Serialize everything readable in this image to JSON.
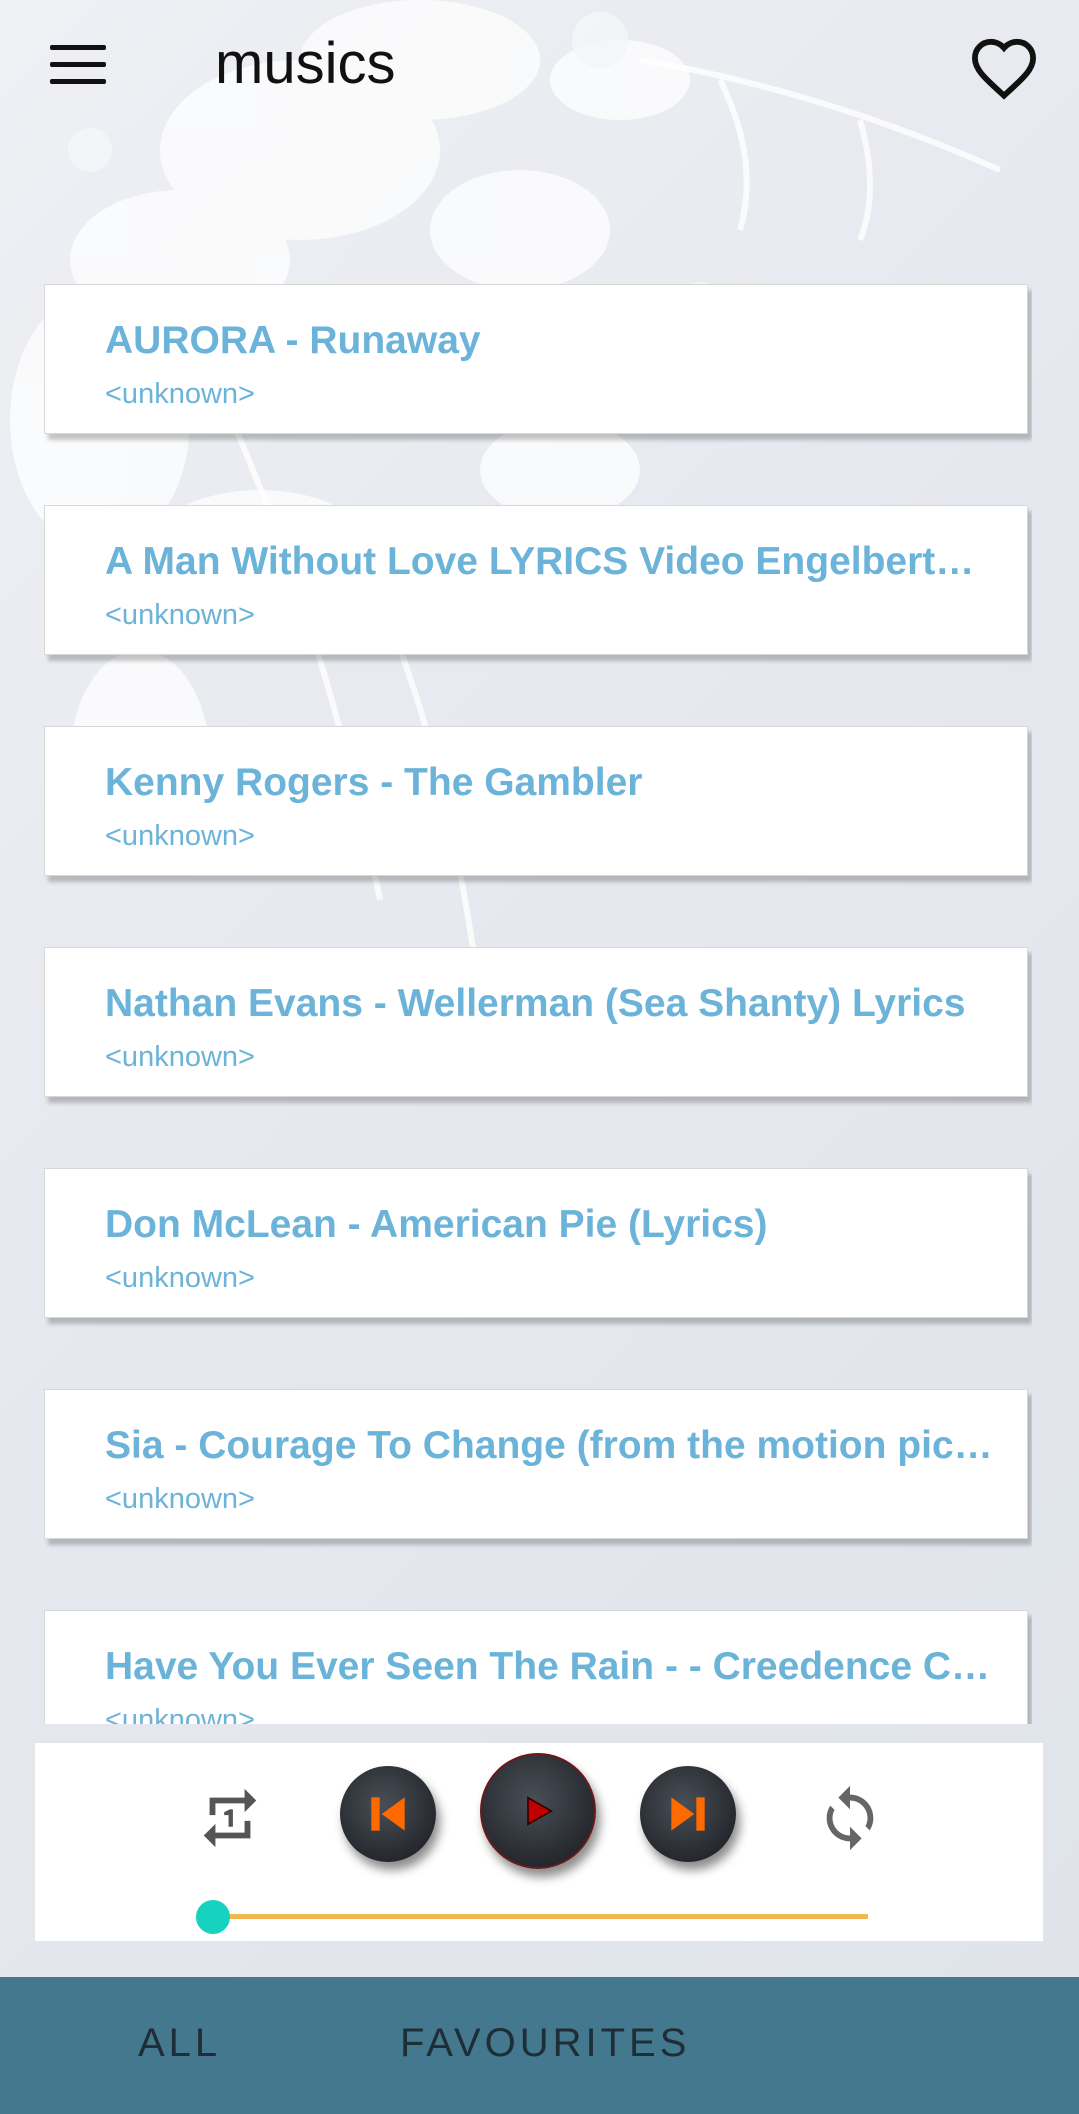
{
  "app": {
    "title": "musics",
    "menu_icon": "hamburger-menu-icon",
    "favourites_icon": "heart-icon"
  },
  "songs": [
    {
      "title": "AURORA - Runaway",
      "artist": "<unknown>"
    },
    {
      "title": "A Man Without Love LYRICS Video Engelbert…",
      "artist": "<unknown>"
    },
    {
      "title": "Kenny Rogers - The Gambler",
      "artist": "<unknown>"
    },
    {
      "title": "Nathan Evans - Wellerman (Sea Shanty) Lyrics",
      "artist": "<unknown>"
    },
    {
      "title": "Don McLean - American Pie (Lyrics)",
      "artist": "<unknown>"
    },
    {
      "title": "Sia - Courage To Change (from the motion pic…",
      "artist": "<unknown>"
    },
    {
      "title": "Have You Ever Seen The Rain - - Creedence C…",
      "artist": "<unknown>"
    }
  ],
  "player": {
    "repeat_icon": "repeat-one-icon",
    "prev_icon": "skip-previous-icon",
    "play_icon": "play-icon",
    "next_icon": "skip-next-icon",
    "shuffle_icon": "refresh-loop-icon",
    "progress": 0.0
  },
  "tabs": [
    {
      "label": "ALL"
    },
    {
      "label": "FAVOURITES"
    }
  ],
  "colors": {
    "song_text": "#6bb3d8",
    "tabbar": "#44788f",
    "progress_track": "#f0b84e",
    "progress_thumb": "#16d3c0",
    "skip_accent": "#ff6a00",
    "play_accent": "#c00000"
  }
}
